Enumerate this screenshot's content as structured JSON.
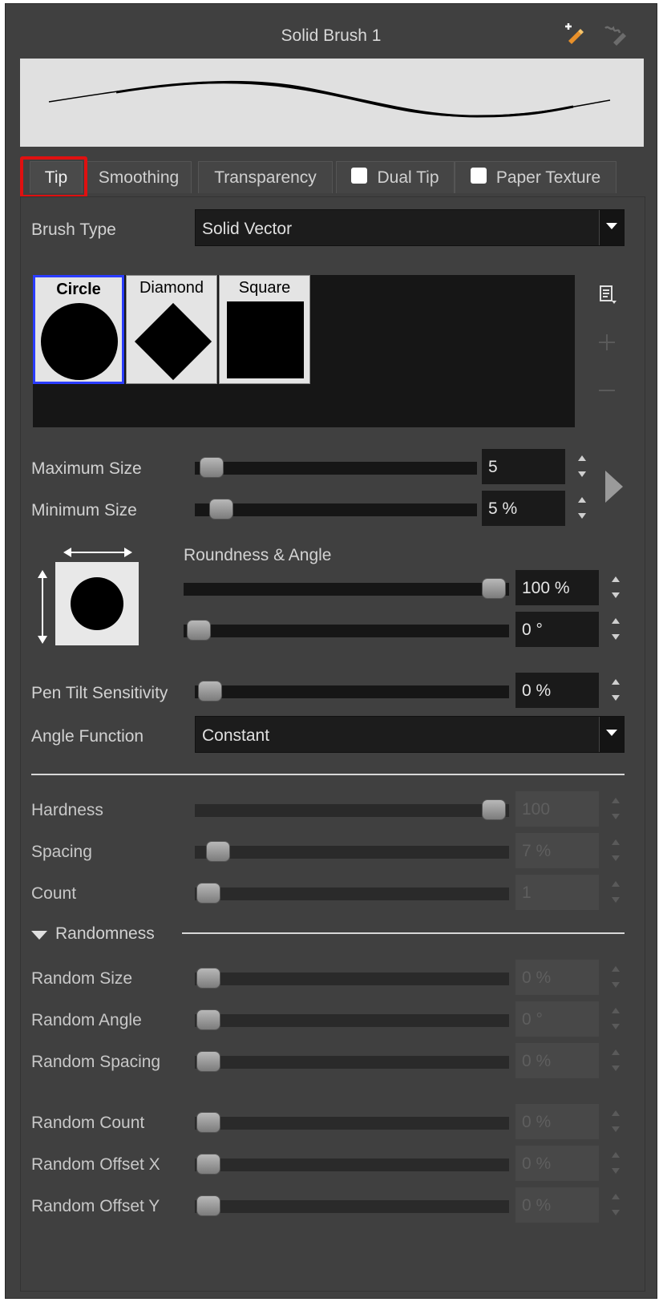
{
  "window": {
    "title": "Solid Brush 1",
    "icons": [
      "add-brush-icon",
      "brush-edit-icon"
    ]
  },
  "tabs": [
    {
      "label": "Tip",
      "active": true,
      "checkbox": false
    },
    {
      "label": "Smoothing",
      "active": false,
      "checkbox": false
    },
    {
      "label": "Transparency",
      "active": false,
      "checkbox": false
    },
    {
      "label": "Dual Tip",
      "active": false,
      "checkbox": true
    },
    {
      "label": "Paper Texture",
      "active": false,
      "checkbox": true
    }
  ],
  "brush_type": {
    "label": "Brush Type",
    "value": "Solid Vector"
  },
  "tips": [
    {
      "name": "Circle",
      "selected": true
    },
    {
      "name": "Diamond",
      "selected": false
    },
    {
      "name": "Square",
      "selected": false
    }
  ],
  "size": {
    "max_label": "Maximum Size",
    "max_value": "5",
    "min_label": "Minimum Size",
    "min_value": "5 %"
  },
  "roundness": {
    "label": "Roundness & Angle",
    "roundness_value": "100 %",
    "angle_value": "0 °"
  },
  "pen_tilt": {
    "label": "Pen Tilt Sensitivity",
    "value": "0 %"
  },
  "angle_function": {
    "label": "Angle Function",
    "value": "Constant"
  },
  "hardness": {
    "label": "Hardness",
    "value": "100"
  },
  "spacing": {
    "label": "Spacing",
    "value": "7 %"
  },
  "count": {
    "label": "Count",
    "value": "1"
  },
  "randomness": {
    "label": "Randomness"
  },
  "random": {
    "size_label": "Random Size",
    "size_value": "0 %",
    "angle_label": "Random Angle",
    "angle_value": "0 °",
    "spacing_label": "Random Spacing",
    "spacing_value": "0 %",
    "count_label": "Random Count",
    "count_value": "0 %",
    "offx_label": "Random Offset X",
    "offx_value": "0 %",
    "offy_label": "Random Offset Y",
    "offy_value": "0 %"
  },
  "colors": {
    "panel": "#404040",
    "highlight": "#e01010",
    "selection": "#2a3cff"
  }
}
